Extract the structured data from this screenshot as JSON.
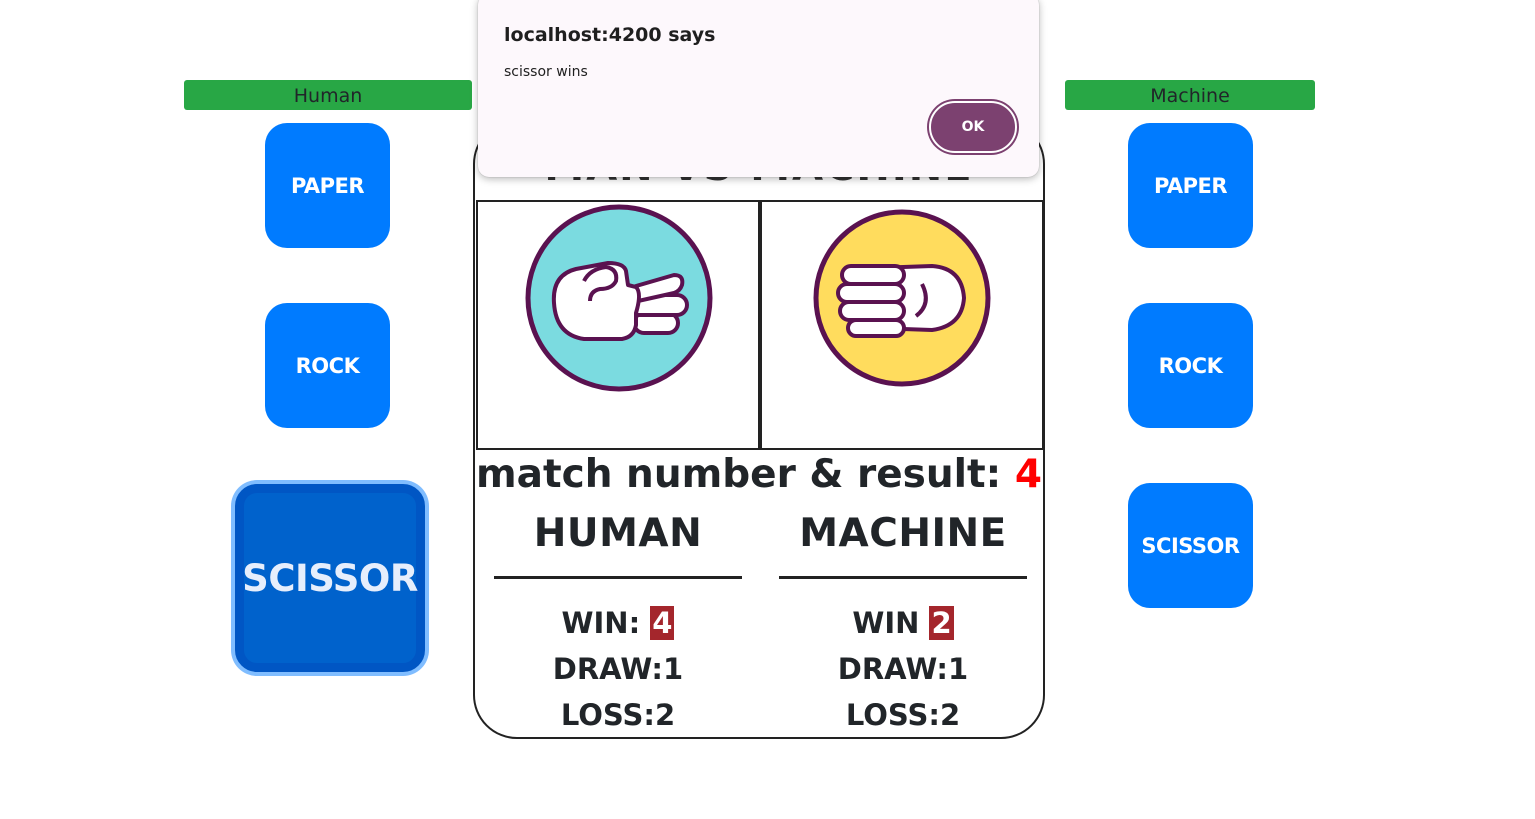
{
  "players": {
    "human": {
      "label": "Human",
      "buttons": {
        "paper": "PAPER",
        "rock": "ROCK",
        "scissor": "SCISSOR"
      },
      "selected": "scissor"
    },
    "machine": {
      "label": "Machine",
      "buttons": {
        "paper": "PAPER",
        "rock": "ROCK",
        "scissor": "SCISSOR"
      }
    }
  },
  "scoreboard": {
    "title": "MAN VS MACHINE",
    "match_label": "match number & result:",
    "match_number": "4",
    "human": {
      "heading": "HUMAN",
      "win_label": "WIN: ",
      "win_value": "4",
      "draw": "DRAW:1",
      "loss": "LOSS:2",
      "hand_icon": "scissors-hand-icon"
    },
    "machine": {
      "heading": "MACHINE",
      "win_label": "WIN ",
      "win_value": "2",
      "draw": "DRAW:1",
      "loss": "LOSS:2",
      "hand_icon": "paper-hand-icon"
    }
  },
  "dialog": {
    "title": "localhost:4200 says",
    "message": "scissor wins",
    "ok_label": "OK"
  },
  "colors": {
    "label_green": "#28a745",
    "button_blue": "#007bff",
    "win_badge": "#a4262c",
    "match_number": "#ff0000",
    "dialog_accent": "#7c4170"
  }
}
